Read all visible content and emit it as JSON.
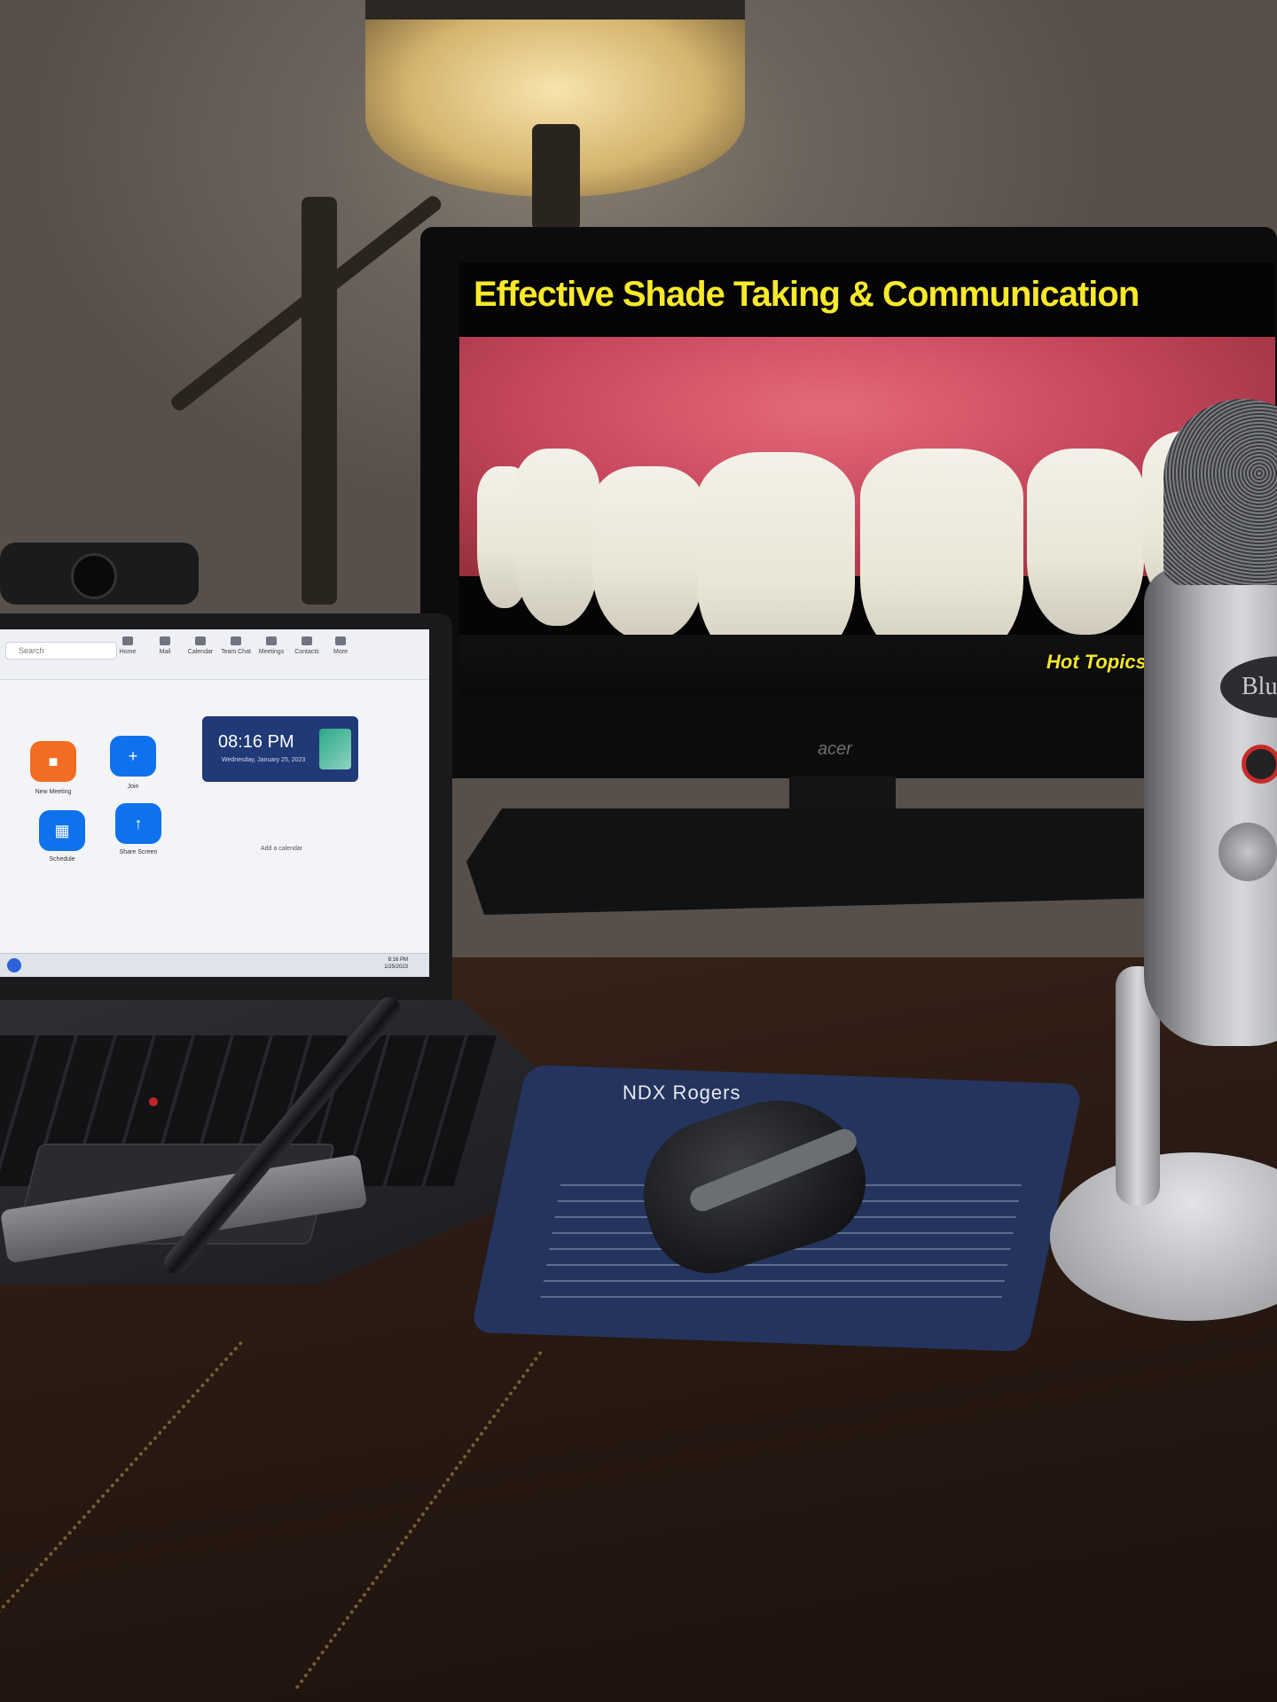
{
  "slide": {
    "title": "Effective Shade Taking & Communication",
    "footer": "Hot Topics In Dentistry"
  },
  "monitor": {
    "brand": "acer"
  },
  "laptop": {
    "search_placeholder": "Search",
    "nav": [
      "Home",
      "Mail",
      "Calendar",
      "Team Chat",
      "Meetings",
      "Contacts",
      "More"
    ],
    "clock": {
      "time": "08:16 PM",
      "date": "Wednesday, January 25, 2023"
    },
    "actions": [
      {
        "label": "New Meeting",
        "icon": "video-camera-icon",
        "color": "#f26d21"
      },
      {
        "label": "Join",
        "icon": "plus-icon",
        "color": "#0e72ed"
      },
      {
        "label": "Schedule",
        "icon": "calendar-icon",
        "color": "#0e72ed"
      },
      {
        "label": "Share Screen",
        "icon": "share-screen-icon",
        "color": "#0e72ed"
      }
    ],
    "add_calendar": "Add a calendar",
    "taskbar_time": "8:16 PM",
    "taskbar_date": "1/25/2023"
  },
  "mousepad": {
    "brand": "NDX Rogers"
  },
  "microphone": {
    "brand": "Blue"
  },
  "colors": {
    "slide_title": "#f8e92a",
    "zoom_card": "#203a77"
  }
}
